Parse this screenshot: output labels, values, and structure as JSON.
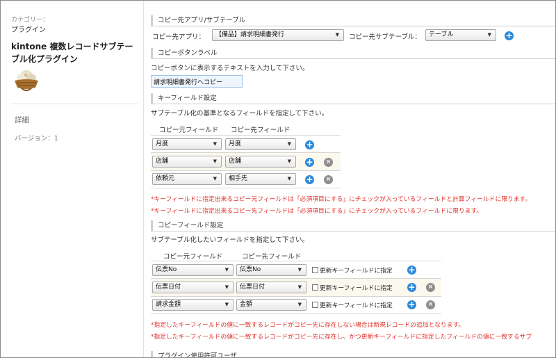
{
  "sidebar": {
    "category_label": "カテゴリー：",
    "category_value": "プラグイン",
    "plugin_title": "kintone 複数レコードサブテーブル化プラグイン",
    "detail_link": "詳細",
    "version": "バージョン：1"
  },
  "copy_target": {
    "title": "コピー先アプリ/サブテーブル",
    "app_label": "コピー先アプリ：",
    "app_value": "【備品】請求明細書発行",
    "subtable_label": "コピー先サブテーブル：",
    "subtable_value": "テーブル"
  },
  "copy_button": {
    "title": "コピーボタンラベル",
    "desc": "コピーボタンに表示するテキストを入力して下さい。",
    "value": "請求明細書発行へコピー"
  },
  "key_fields": {
    "title": "キーフィールド設定",
    "desc": "サブテーブル化の基準となるフィールドを指定して下さい。",
    "col_src": "コピー元フィールド",
    "col_dst": "コピー先フィールド",
    "rows": [
      {
        "src": "月度",
        "dst": "月度"
      },
      {
        "src": "店舗",
        "dst": "店舗"
      },
      {
        "src": "依頼元",
        "dst": "相手先"
      }
    ],
    "note1": "*キーフィールドに指定出来るコピー元フィールドは「必須項目にする」にチェックが入っているフィールドと計算フィールドに限ります。",
    "note2": "*キーフィールドに指定出来るコピー先フィールドは「必須項目にする」にチェックが入っているフィールドに限ります。"
  },
  "copy_fields": {
    "title": "コピーフィールド設定",
    "desc": "サブテーブル化したいフィールドを指定して下さい。",
    "col_src": "コピー元フィールド",
    "col_dst": "コピー先フィールド",
    "checkbox_label": "更新キーフィールドに指定",
    "rows": [
      {
        "src": "伝票No",
        "dst": "伝票No",
        "checked": false
      },
      {
        "src": "伝票日付",
        "dst": "伝票日付",
        "checked": false
      },
      {
        "src": "請求金額",
        "dst": "金額",
        "checked": false
      }
    ],
    "note1": "*指定したキーフィールドの値に一致するレコードがコピー先に存在しない場合は新規レコードの追加となります。",
    "note2": "*指定したキーフィールドの値に一致するレコードがコピー先に存在し、かつ更新キーフィールドに指定したフィールドの値に一致するサブ"
  },
  "permission": {
    "title": "プラグイン使用許可ユーザ"
  },
  "icons": {
    "add": "plus-circle-icon",
    "remove": "x-circle-icon",
    "dropdown": "chevron-down-icon"
  },
  "colors": {
    "accent_blue": "#2e8ad8",
    "note_red": "#e0302a",
    "row_highlight": "#fbf8ee"
  },
  "glyphs": {
    "plus": "+",
    "cross": "×",
    "arrow": "▼"
  }
}
